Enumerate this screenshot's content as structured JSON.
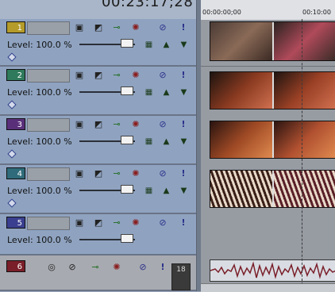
{
  "header": {
    "timecode": "00:23:17;28"
  },
  "ruler": {
    "start": "00:00:00;00",
    "mark": "00:10:00"
  },
  "tracks": [
    {
      "number": "1",
      "color": "#b49b2a",
      "level_label": "Level: 100.0 %"
    },
    {
      "number": "2",
      "color": "#2f7a5c",
      "level_label": "Level: 100.0 %"
    },
    {
      "number": "3",
      "color": "#5a2f7a",
      "level_label": "Level: 100.0 %"
    },
    {
      "number": "4",
      "color": "#2f6b7a",
      "level_label": "Level: 100.0 %"
    },
    {
      "number": "5",
      "color": "#3a3f8f",
      "level_label": "Level: 100.0 %"
    }
  ],
  "audio_track": {
    "number": "6",
    "color": "#7a1f2a",
    "meter_label": "18"
  },
  "icons": {
    "compositing": "compositing-icon",
    "mask": "mask-icon",
    "effects": "track-fx-icon",
    "motion": "track-motion-icon",
    "mute": "mute-icon",
    "solo": "solo-icon"
  }
}
